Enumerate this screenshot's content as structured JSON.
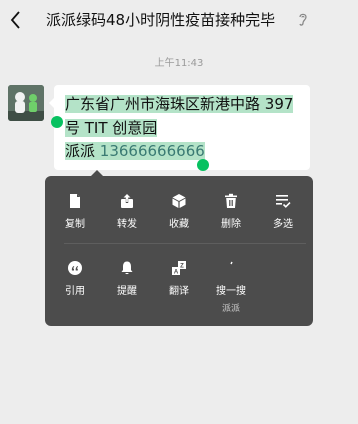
{
  "header": {
    "title": "派派绿码48小时阴性疫苗接种完毕",
    "back_icon": "chevron-left-icon",
    "ear_icon": "ear-icon"
  },
  "timestamp": "上午11:43",
  "message": {
    "line1": "广东省广州市海珠区新港中路 397",
    "line2": "号 TIT 创意园",
    "line3_name": "派派",
    "line3_phone": "13666666666"
  },
  "colors": {
    "accent": "#07c160",
    "highlight": "#b4e3c8",
    "menu_bg": "#4c4c4c"
  },
  "menu": {
    "row1": [
      {
        "label": "复制",
        "icon": "copy-icon"
      },
      {
        "label": "转发",
        "icon": "forward-icon"
      },
      {
        "label": "收藏",
        "icon": "favorite-icon"
      },
      {
        "label": "删除",
        "icon": "delete-icon"
      },
      {
        "label": "多选",
        "icon": "multi-select-icon"
      }
    ],
    "row2": [
      {
        "label": "引用",
        "icon": "quote-icon"
      },
      {
        "label": "提醒",
        "icon": "remind-bell-icon"
      },
      {
        "label": "翻译",
        "icon": "translate-icon"
      },
      {
        "label": "搜一搜",
        "sub": "派派",
        "icon": "search-icon"
      }
    ]
  }
}
